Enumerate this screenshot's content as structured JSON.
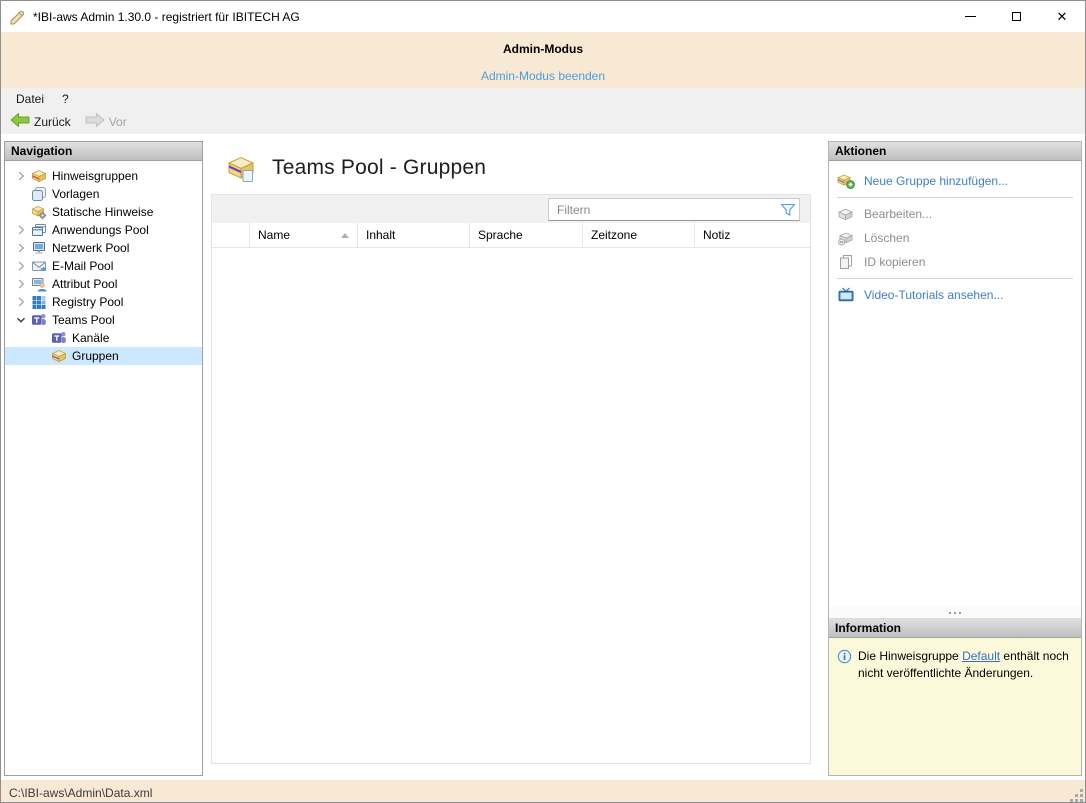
{
  "window": {
    "title": "*IBI-aws Admin 1.30.0 - registriert für IBITECH AG"
  },
  "admin_banner": {
    "title": "Admin-Modus",
    "exit_link": "Admin-Modus beenden"
  },
  "menu": {
    "items": [
      {
        "label": "Datei"
      },
      {
        "label": "?"
      }
    ]
  },
  "toolbar": {
    "back_label": "Zurück",
    "forward_label": "Vor"
  },
  "navigation": {
    "header": "Navigation",
    "items": [
      {
        "label": "Hinweisgruppen",
        "icon": "notice-group-icon",
        "expand": "collapsed",
        "level": 0,
        "selected": false
      },
      {
        "label": "Vorlagen",
        "icon": "templates-icon",
        "expand": "none",
        "level": 0,
        "selected": false
      },
      {
        "label": "Statische Hinweise",
        "icon": "static-notice-icon",
        "expand": "none",
        "level": 0,
        "selected": false
      },
      {
        "label": "Anwendungs Pool",
        "icon": "application-pool-icon",
        "expand": "collapsed",
        "level": 0,
        "selected": false
      },
      {
        "label": "Netzwerk Pool",
        "icon": "network-pool-icon",
        "expand": "collapsed",
        "level": 0,
        "selected": false
      },
      {
        "label": "E-Mail Pool",
        "icon": "email-pool-icon",
        "expand": "collapsed",
        "level": 0,
        "selected": false
      },
      {
        "label": "Attribut Pool",
        "icon": "attribute-pool-icon",
        "expand": "collapsed",
        "level": 0,
        "selected": false
      },
      {
        "label": "Registry Pool",
        "icon": "registry-pool-icon",
        "expand": "collapsed",
        "level": 0,
        "selected": false
      },
      {
        "label": "Teams Pool",
        "icon": "teams-pool-icon",
        "expand": "expanded",
        "level": 0,
        "selected": false
      },
      {
        "label": "Kanäle",
        "icon": "teams-channel-icon",
        "expand": "none",
        "level": 1,
        "selected": false
      },
      {
        "label": "Gruppen",
        "icon": "group-box-icon",
        "expand": "none",
        "level": 1,
        "selected": true
      }
    ]
  },
  "main": {
    "title": "Teams Pool - Gruppen",
    "filter_placeholder": "Filtern",
    "table": {
      "columns": [
        "Name",
        "Inhalt",
        "Sprache",
        "Zeitzone",
        "Notiz"
      ],
      "sorted_by": "Name",
      "sort_direction": "asc",
      "rows": []
    }
  },
  "actions": {
    "header": "Aktionen",
    "items": [
      {
        "label": "Neue Gruppe hinzufügen...",
        "icon": "add-group-icon",
        "enabled": true
      },
      {
        "label": "Bearbeiten...",
        "icon": "edit-group-icon",
        "enabled": false
      },
      {
        "label": "Löschen",
        "icon": "delete-group-icon",
        "enabled": false
      },
      {
        "label": "ID kopieren",
        "icon": "copy-id-icon",
        "enabled": false
      },
      {
        "label": "Video-Tutorials ansehen...",
        "icon": "video-tutorials-icon",
        "enabled": true
      }
    ]
  },
  "information": {
    "header": "Information",
    "message_prefix": "Die Hinweisgruppe ",
    "message_link": "Default",
    "message_suffix": " enthält noch nicht veröffentlichte Änderungen."
  },
  "statusbar": {
    "path": "C:\\IBI-aws\\Admin\\Data.xml"
  },
  "colors": {
    "banner_bg": "#f8e9d4",
    "banner_link": "#4aa0dc",
    "action_link": "#3e7fc1",
    "selection_bg": "#cce8ff",
    "info_bg": "#fbf9d9",
    "chrome_bg": "#f0f0f0"
  }
}
